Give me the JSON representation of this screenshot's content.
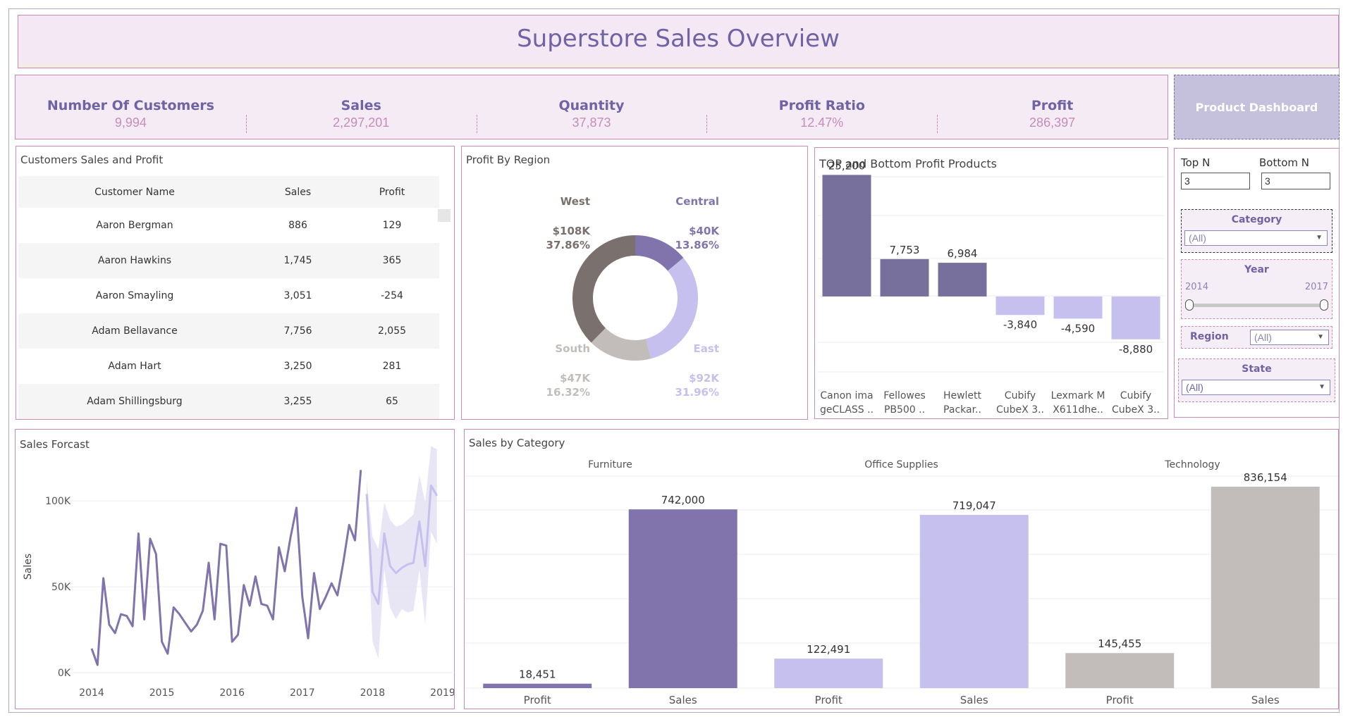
{
  "dashboard": {
    "title": "Superstore Sales Overview"
  },
  "kpis": [
    {
      "label": "Number Of Customers",
      "value": "9,994"
    },
    {
      "label": "Sales",
      "value": "2,297,201"
    },
    {
      "label": "Quantity",
      "value": "37,873"
    },
    {
      "label": "Profit Ratio",
      "value": "12.47%"
    },
    {
      "label": "Profit",
      "value": "286,397"
    }
  ],
  "product_button": {
    "label": "Product Dashboard"
  },
  "customers": {
    "title": "Customers Sales and Profit",
    "columns": [
      "Customer Name",
      "Sales",
      "Profit"
    ],
    "rows": [
      [
        "Aaron Bergman",
        "886",
        "129"
      ],
      [
        "Aaron Hawkins",
        "1,745",
        "365"
      ],
      [
        "Aaron Smayling",
        "3,051",
        "-254"
      ],
      [
        "Adam Bellavance",
        "7,756",
        "2,055"
      ],
      [
        "Adam Hart",
        "3,250",
        "281"
      ],
      [
        "Adam Shillingsburg",
        "3,255",
        "65"
      ]
    ]
  },
  "filters": {
    "top_n_label": "Top N",
    "top_n_value": "3",
    "bottom_n_label": "Bottom N",
    "bottom_n_value": "3",
    "category": {
      "title": "Category",
      "value": "(All)"
    },
    "year": {
      "title": "Year",
      "start": "2014",
      "end": "2017"
    },
    "region": {
      "title": "Region",
      "value": "(All)"
    },
    "state": {
      "title": "State",
      "value": "(All)"
    }
  },
  "colors": {
    "accent": "#6f62a5",
    "purple": "#8174ad",
    "lavender": "#c5c0ee",
    "gray": "#c2bdbb",
    "dark_gray": "#7a706e",
    "pink_border": "#c88bb8"
  },
  "chart_data": [
    {
      "id": "profit_by_region",
      "type": "pie",
      "title": "Profit By Region",
      "slices": [
        {
          "label": "Central",
          "value": 40,
          "value_label": "$40K",
          "percent": "13.86%",
          "color": "#8174ad"
        },
        {
          "label": "East",
          "value": 92,
          "value_label": "$92K",
          "percent": "31.96%",
          "color": "#c5c0ee"
        },
        {
          "label": "South",
          "value": 47,
          "value_label": "$47K",
          "percent": "16.32%",
          "color": "#c2bdbb"
        },
        {
          "label": "West",
          "value": 108,
          "value_label": "$108K",
          "percent": "37.86%",
          "color": "#7a706e"
        }
      ]
    },
    {
      "id": "top_bottom_products",
      "type": "bar",
      "title": "TOP and Bottom Profit  Products",
      "categories": [
        [
          "Canon ima",
          "geCLASS .."
        ],
        [
          "Fellowes",
          "PB500 .."
        ],
        [
          "Hewlett",
          "Packar.."
        ],
        [
          "Cubify",
          "CubeX 3.."
        ],
        [
          "Lexmark M",
          "X611dhe.."
        ],
        [
          "Cubify",
          "CubeX 3.."
        ]
      ],
      "values": [
        25200,
        7753,
        6984,
        -3840,
        -4590,
        -8880
      ],
      "labels": [
        "25,200",
        "7,753",
        "6,984",
        "-3,840",
        "-4,590",
        "-8,880"
      ],
      "ylim": [
        -9500,
        27000
      ]
    },
    {
      "id": "sales_forecast",
      "type": "line",
      "title": "Sales Forcast",
      "ylabel": "Sales",
      "x_ticks": [
        "2014",
        "2015",
        "2016",
        "2017",
        "2018",
        "2019"
      ],
      "y_ticks": [
        0,
        50000,
        100000
      ],
      "y_tick_labels": [
        "0K",
        "50K",
        "100K"
      ],
      "ylim": [
        0,
        130000
      ],
      "xlim": [
        2014,
        2019
      ],
      "actual": [
        [
          2014.0,
          14000
        ],
        [
          2014.083,
          4500
        ],
        [
          2014.167,
          55000
        ],
        [
          2014.25,
          28000
        ],
        [
          2014.333,
          23000
        ],
        [
          2014.417,
          34000
        ],
        [
          2014.5,
          33000
        ],
        [
          2014.583,
          27000
        ],
        [
          2014.667,
          81000
        ],
        [
          2014.75,
          31000
        ],
        [
          2014.833,
          78000
        ],
        [
          2014.917,
          69000
        ],
        [
          2015.0,
          18000
        ],
        [
          2015.083,
          11000
        ],
        [
          2015.167,
          38000
        ],
        [
          2015.25,
          34000
        ],
        [
          2015.333,
          29000
        ],
        [
          2015.417,
          24000
        ],
        [
          2015.5,
          28000
        ],
        [
          2015.583,
          36000
        ],
        [
          2015.667,
          64000
        ],
        [
          2015.75,
          31000
        ],
        [
          2015.833,
          75000
        ],
        [
          2015.917,
          74000
        ],
        [
          2016.0,
          18000
        ],
        [
          2016.083,
          22000
        ],
        [
          2016.167,
          51000
        ],
        [
          2016.25,
          39000
        ],
        [
          2016.333,
          56000
        ],
        [
          2016.417,
          40000
        ],
        [
          2016.5,
          39000
        ],
        [
          2016.583,
          31000
        ],
        [
          2016.667,
          73000
        ],
        [
          2016.75,
          59000
        ],
        [
          2016.833,
          79000
        ],
        [
          2016.917,
          96000
        ],
        [
          2017.0,
          44000
        ],
        [
          2017.083,
          20000
        ],
        [
          2017.167,
          58000
        ],
        [
          2017.25,
          37000
        ],
        [
          2017.333,
          44000
        ],
        [
          2017.417,
          52000
        ],
        [
          2017.5,
          45000
        ],
        [
          2017.583,
          64000
        ],
        [
          2017.667,
          86000
        ],
        [
          2017.75,
          77000
        ],
        [
          2017.833,
          118000
        ]
      ],
      "forecast": [
        [
          2017.917,
          104000
        ],
        [
          2018.0,
          47000
        ],
        [
          2018.083,
          40000
        ],
        [
          2018.167,
          81000
        ],
        [
          2018.25,
          62000
        ],
        [
          2018.333,
          58000
        ],
        [
          2018.417,
          61000
        ],
        [
          2018.5,
          63000
        ],
        [
          2018.583,
          64000
        ],
        [
          2018.667,
          88000
        ],
        [
          2018.75,
          62000
        ],
        [
          2018.833,
          109000
        ],
        [
          2018.917,
          103000
        ]
      ],
      "forecast_upper": [
        [
          2017.917,
          112000
        ],
        [
          2018.0,
          79000
        ],
        [
          2018.083,
          72000
        ],
        [
          2018.167,
          99000
        ],
        [
          2018.25,
          89000
        ],
        [
          2018.333,
          85000
        ],
        [
          2018.417,
          86000
        ],
        [
          2018.5,
          89000
        ],
        [
          2018.583,
          92000
        ],
        [
          2018.667,
          115000
        ],
        [
          2018.75,
          99000
        ],
        [
          2018.833,
          132000
        ],
        [
          2018.917,
          130000
        ]
      ],
      "forecast_lower": [
        [
          2017.917,
          96000
        ],
        [
          2018.0,
          18000
        ],
        [
          2018.083,
          8000
        ],
        [
          2018.167,
          60000
        ],
        [
          2018.25,
          38000
        ],
        [
          2018.333,
          31000
        ],
        [
          2018.417,
          37000
        ],
        [
          2018.5,
          35000
        ],
        [
          2018.583,
          36000
        ],
        [
          2018.667,
          60000
        ],
        [
          2018.75,
          28000
        ],
        [
          2018.833,
          82000
        ],
        [
          2018.917,
          75000
        ]
      ]
    },
    {
      "id": "sales_by_category",
      "type": "bar",
      "title": "Sales by Category",
      "groups": [
        "Furniture",
        "Office Supplies",
        "Technology"
      ],
      "bars": [
        {
          "group": "Furniture",
          "label": "Profit",
          "value": 18451,
          "value_label": "18,451",
          "color": "#8174ad"
        },
        {
          "group": "Furniture",
          "label": "Sales",
          "value": 742000,
          "value_label": "742,000",
          "color": "#8174ad"
        },
        {
          "group": "Office Supplies",
          "label": "Profit",
          "value": 122491,
          "value_label": "122,491",
          "color": "#c5c0ee"
        },
        {
          "group": "Office Supplies",
          "label": "Sales",
          "value": 719047,
          "value_label": "719,047",
          "color": "#c5c0ee"
        },
        {
          "group": "Technology",
          "label": "Profit",
          "value": 145455,
          "value_label": "145,455",
          "color": "#c2bdbb"
        },
        {
          "group": "Technology",
          "label": "Sales",
          "value": 836154,
          "value_label": "836,154",
          "color": "#c2bdbb"
        }
      ],
      "ylim": [
        0,
        880000
      ]
    }
  ]
}
